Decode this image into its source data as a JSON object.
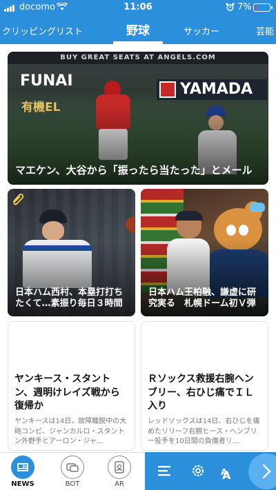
{
  "status_bar": {
    "carrier": "docomo",
    "time": "11:06",
    "battery_percent": "7%",
    "battery_level": 0.07,
    "icons": [
      "signal-icon",
      "wifi-icon",
      "alarm-icon",
      "battery-icon"
    ]
  },
  "tabs": [
    {
      "label": "クリッピングリスト",
      "active": false
    },
    {
      "label": "野球",
      "active": true
    },
    {
      "label": "サッカー",
      "active": false
    },
    {
      "label": "芸能",
      "active": false
    }
  ],
  "articles": {
    "hero": {
      "title": "マエケン、大谷から「振ったら当たった」とメール",
      "photo_banner": "BUY GREAT SEATS AT ANGELS.COM",
      "photo_sign": "FUNAI",
      "photo_sign2": "有機EL",
      "photo_sign3": "YAMADA"
    },
    "left": {
      "title": "日本ハム西村、本塁打打ちたくて…素振り毎日３時間",
      "clipped": true
    },
    "right": {
      "title": "日本ハム王柏融、謙虚に研究実る　札幌ドーム初Ｖ弾"
    },
    "text_left": {
      "headline": "ヤンキース・スタントン、週明けレイズ戦から復帰か",
      "summary": "ヤンキースは14日、故障離脱中の大砲コンビ、ジャンカルロ・スタントン外野手とアーロン・ジャ…"
    },
    "text_right": {
      "headline": "Ｒソックス救援右腕ヘンブリー、右ひじ痛でＩＬ入り",
      "summary": "レッドソックスは14日、右ひじを痛めたリリーフ右腕ヒース・ヘンブリー投手を10日間の負傷者リ…"
    }
  },
  "bottom_nav": [
    {
      "label": "NEWS",
      "icon": "news-icon",
      "active": true
    },
    {
      "label": "BOT",
      "icon": "bot-icon",
      "active": false
    },
    {
      "label": "AR",
      "icon": "ar-icon",
      "active": false
    }
  ],
  "toolbar": {
    "icons": [
      "menu-icon",
      "gear-icon",
      "font-size-icon",
      "chevron-right-icon"
    ],
    "font_label_big": "A",
    "font_label_small": "A"
  },
  "colors": {
    "brand_blue": "#2c8fdb",
    "next_button": "#5bb0ef",
    "battery_low": "#e53935"
  }
}
